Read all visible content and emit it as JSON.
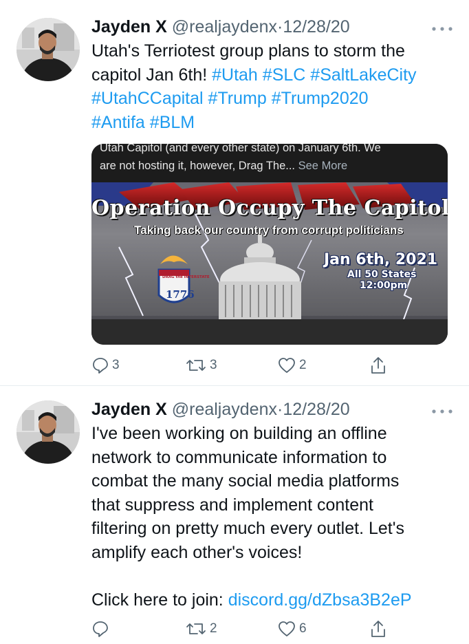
{
  "tweets": [
    {
      "author_name": "Jayden X",
      "handle": "@realjaydenx",
      "separator": "·",
      "date": "12/28/20",
      "text_lines": [
        [
          {
            "t": "Utah's Terriotest group plans to storm the",
            "c": "plain"
          }
        ],
        [
          {
            "t": "capitol Jan 6th! ",
            "c": "plain"
          },
          {
            "t": "#Utah",
            "c": "tag"
          },
          {
            "t": " ",
            "c": "plain"
          },
          {
            "t": "#SLC",
            "c": "tag"
          },
          {
            "t": " ",
            "c": "plain"
          },
          {
            "t": "#SaltLakeCity",
            "c": "tag"
          }
        ],
        [
          {
            "t": "#UtahCCapital",
            "c": "tag"
          },
          {
            "t": " ",
            "c": "plain"
          },
          {
            "t": "#Trump",
            "c": "tag"
          },
          {
            "t": " ",
            "c": "plain"
          },
          {
            "t": "#Trump2020",
            "c": "tag"
          }
        ],
        [
          {
            "t": "#Antifa",
            "c": "tag"
          },
          {
            "t": " ",
            "c": "plain"
          },
          {
            "t": "#BLM",
            "c": "tag"
          }
        ]
      ],
      "card": {
        "caption_line1": "Utah Capitol (and every other state) on January 6th. We",
        "caption_line2": "are not hosting it, however, Drag The...",
        "see_more": "See More",
        "poster_title": "Operation Occupy The Capitol",
        "poster_subtitle": "Taking back our country from corrupt politicians",
        "poster_date": "Jan 6th, 2021",
        "poster_states": "All 50 States",
        "poster_time": "12:00pm",
        "badge_top": "DRAG the INTERSTATE",
        "badge_year": "1776"
      },
      "actions": {
        "reply_count": "3",
        "retweet_count": "3",
        "like_count": "2",
        "share_count": ""
      }
    },
    {
      "author_name": "Jayden X",
      "handle": "@realjaydenx",
      "separator": "·",
      "date": "12/28/20",
      "text_lines": [
        [
          {
            "t": "I've been working on building an offline",
            "c": "plain"
          }
        ],
        [
          {
            "t": "network to communicate information to",
            "c": "plain"
          }
        ],
        [
          {
            "t": "combat the many social media platforms",
            "c": "plain"
          }
        ],
        [
          {
            "t": "that suppress and implement content",
            "c": "plain"
          }
        ],
        [
          {
            "t": "filtering on pretty much every outlet. Let's",
            "c": "plain"
          }
        ],
        [
          {
            "t": "amplify each other's voices!",
            "c": "plain"
          }
        ],
        [
          {
            "t": "",
            "c": "plain"
          }
        ],
        [
          {
            "t": "Click here to join: ",
            "c": "plain"
          },
          {
            "t": "discord.gg/dZbsa3B2eP",
            "c": "link"
          }
        ]
      ],
      "actions": {
        "reply_count": "",
        "retweet_count": "2",
        "like_count": "6",
        "share_count": ""
      }
    }
  ],
  "colors": {
    "link_blue": "#1d9bf0",
    "secondary_gray": "#536471",
    "divider": "#e6ecf0"
  },
  "icons": [
    "more-icon",
    "reply-icon",
    "retweet-icon",
    "like-icon",
    "share-icon"
  ]
}
